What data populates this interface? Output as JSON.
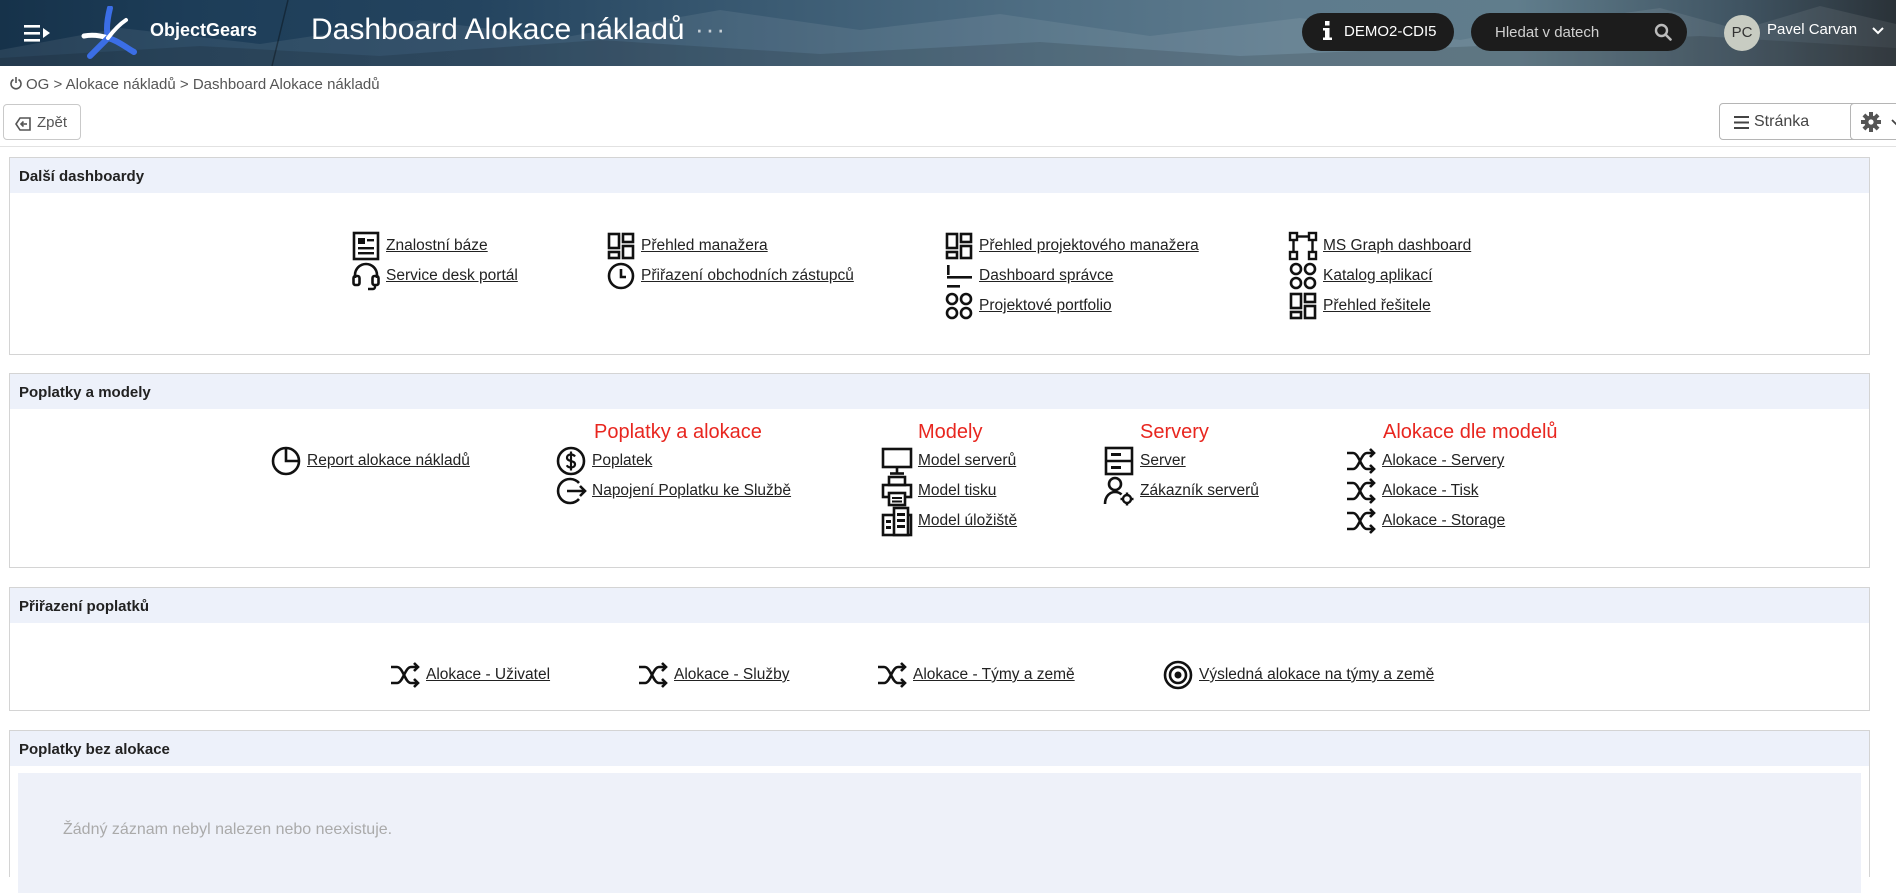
{
  "header": {
    "brand": "ObjectGears",
    "title": "Dashboard Alokace nákladů",
    "more": "···",
    "environment": "DEMO2-CDI5",
    "search": {
      "placeholder": "Hledat v datech"
    },
    "user": {
      "initials": "PC",
      "name": "Pavel Carvan"
    }
  },
  "breadcrumb": {
    "root": "OG",
    "sep": ">",
    "level1": "Alokace nákladů",
    "level2": "Dashboard Alokace nákladů"
  },
  "toolbar": {
    "back_label": "Zpět",
    "page_label": "Stránka"
  },
  "panels": {
    "dalsi": {
      "title": "Další dashboardy",
      "items": [
        {
          "label": "Znalostní báze",
          "icon": "article-icon"
        },
        {
          "label": "Service desk portál",
          "icon": "headset-icon"
        },
        {
          "label": "Přehled manažera",
          "icon": "dashboard-icon"
        },
        {
          "label": "Přiřazení obchodních zástupců",
          "icon": "clock-icon"
        },
        {
          "label": "Přehled projektového manažera",
          "icon": "dashboard-icon"
        },
        {
          "label": "Dashboard správce",
          "icon": "list-lines-icon"
        },
        {
          "label": "Projektové portfolio",
          "icon": "apps-icon"
        },
        {
          "label": "MS Graph dashboard",
          "icon": "graph-icon"
        },
        {
          "label": "Katalog aplikací",
          "icon": "apps-icon"
        },
        {
          "label": "Přehled řešitele",
          "icon": "dashboard-icon"
        }
      ]
    },
    "poplatky": {
      "title": "Poplatky a modely",
      "groups": {
        "poplatky": "Poplatky a alokace",
        "modely": "Modely",
        "servery": "Servery",
        "alokace": "Alokace dle modelů"
      },
      "items": [
        {
          "label": "Report alokace nákladů",
          "icon": "pie-chart-icon"
        },
        {
          "label": "Poplatek",
          "icon": "dollar-icon"
        },
        {
          "label": "Napojení Poplatku ke Službě",
          "icon": "link-out-icon"
        },
        {
          "label": "Model serverů",
          "icon": "monitor-icon"
        },
        {
          "label": "Model tisku",
          "icon": "printer-icon"
        },
        {
          "label": "Model úložiště",
          "icon": "storage-icon"
        },
        {
          "label": "Server",
          "icon": "server-icon"
        },
        {
          "label": "Zákazník serverů",
          "icon": "user-gear-icon"
        },
        {
          "label": "Alokace - Servery",
          "icon": "shuffle-icon"
        },
        {
          "label": "Alokace - Tisk",
          "icon": "shuffle-icon"
        },
        {
          "label": "Alokace - Storage",
          "icon": "shuffle-icon"
        }
      ]
    },
    "prirazeni": {
      "title": "Přiřazení poplatků",
      "items": [
        {
          "label": "Alokace - Uživatel",
          "icon": "shuffle-icon"
        },
        {
          "label": "Alokace - Služby",
          "icon": "shuffle-icon"
        },
        {
          "label": "Alokace - Týmy a země",
          "icon": "shuffle-icon"
        },
        {
          "label": "Výsledná alokace na týmy a země",
          "icon": "target-icon"
        }
      ]
    },
    "bez": {
      "title": "Poplatky bez alokace",
      "empty": "Žádný záznam nebyl nalezen nebo neexistuje."
    }
  }
}
